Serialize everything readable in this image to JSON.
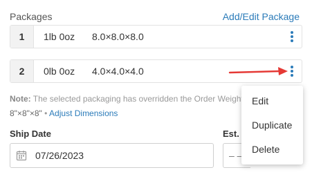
{
  "packages": {
    "title": "Packages",
    "add_edit_label": "Add/Edit Package",
    "rows": [
      {
        "number": "1",
        "weight": "1lb 0oz",
        "dims": "8.0×8.0×8.0"
      },
      {
        "number": "2",
        "weight": "0lb 0oz",
        "dims": "4.0×4.0×4.0"
      }
    ],
    "note_label": "Note:",
    "note_text": " The selected packaging has overridden the Order Weight.",
    "dims_text": "8\"×8\"×8\"",
    "dims_separator": " • ",
    "adjust_label": "Adjust Dimensions"
  },
  "ship_date": {
    "label": "Ship Date",
    "value": "07/26/2023"
  },
  "est": {
    "label": "Est. I",
    "value": "– –"
  },
  "menu": {
    "items": [
      "Edit",
      "Duplicate",
      "Delete"
    ]
  },
  "colors": {
    "link": "#2b7bb9",
    "arrow": "#e53935"
  }
}
